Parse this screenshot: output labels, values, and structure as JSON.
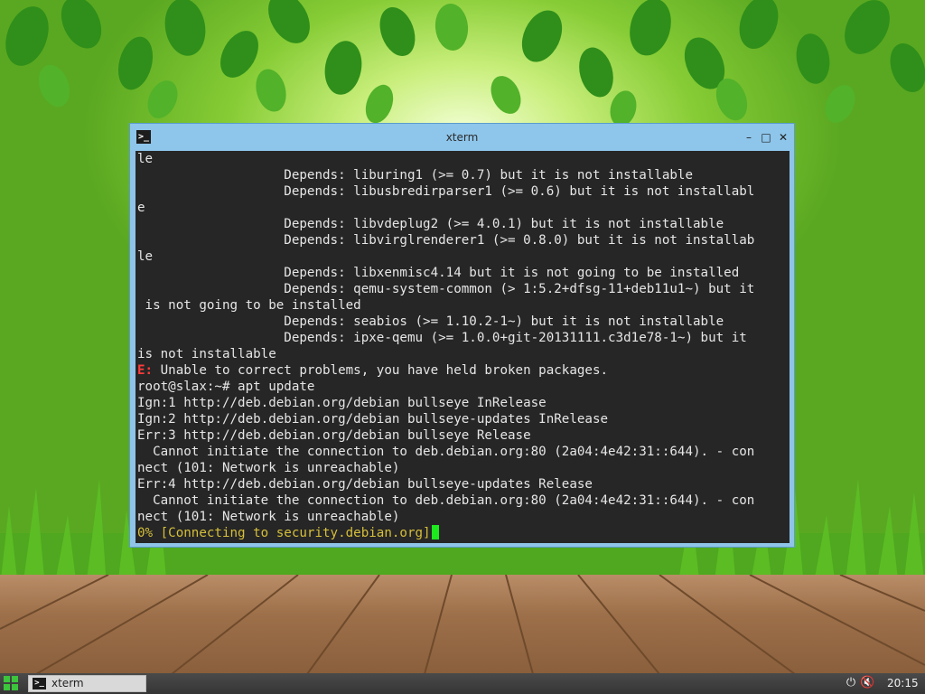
{
  "window": {
    "title": "xterm",
    "icon": "terminal-icon",
    "controls": {
      "minimize": "minimize-icon",
      "maximize": "maximize-icon",
      "close": "close-icon"
    }
  },
  "terminal": {
    "lines": [
      {
        "text": "le"
      },
      {
        "text": "                   Depends: liburing1 (>= 0.7) but it is not installable"
      },
      {
        "text": "                   Depends: libusbredirparser1 (>= 0.6) but it is not installabl"
      },
      {
        "text": "e"
      },
      {
        "text": "                   Depends: libvdeplug2 (>= 4.0.1) but it is not installable"
      },
      {
        "text": "                   Depends: libvirglrenderer1 (>= 0.8.0) but it is not installab"
      },
      {
        "text": "le"
      },
      {
        "text": "                   Depends: libxenmisc4.14 but it is not going to be installed"
      },
      {
        "text": "                   Depends: qemu-system-common (> 1:5.2+dfsg-11+deb11u1~) but it"
      },
      {
        "text": " is not going to be installed"
      },
      {
        "text": "                   Depends: seabios (>= 1.10.2-1~) but it is not installable"
      },
      {
        "text": "                   Depends: ipxe-qemu (>= 1.0.0+git-20131111.c3d1e78-1~) but it"
      },
      {
        "text": "is not installable"
      },
      {
        "prefix": "E:",
        "text": " Unable to correct problems, you have held broken packages."
      },
      {
        "text": "root@slax:~# apt update"
      },
      {
        "text": "Ign:1 http://deb.debian.org/debian bullseye InRelease"
      },
      {
        "text": "Ign:2 http://deb.debian.org/debian bullseye-updates InRelease"
      },
      {
        "text": "Err:3 http://deb.debian.org/debian bullseye Release"
      },
      {
        "text": "  Cannot initiate the connection to deb.debian.org:80 (2a04:4e42:31::644). - con"
      },
      {
        "text": "nect (101: Network is unreachable)"
      },
      {
        "text": "Err:4 http://deb.debian.org/debian bullseye-updates Release"
      },
      {
        "text": "  Cannot initiate the connection to deb.debian.org:80 (2a04:4e42:31::644). - con"
      },
      {
        "text": "nect (101: Network is unreachable)"
      }
    ],
    "progress_line": "0% [Connecting to security.debian.org]",
    "colors": {
      "background": "#262626",
      "foreground": "#e6e6e6",
      "error": "#ff3b3b",
      "progress": "#d6bf3a",
      "cursor": "#1ee81e"
    }
  },
  "taskbar": {
    "start_icon": "app-grid-icon",
    "items": [
      {
        "label": "xterm",
        "icon": "terminal-icon"
      }
    ],
    "tray": {
      "power_icon": "power-icon",
      "volume_icon": "volume-muted-icon",
      "clock": "20:15"
    }
  }
}
